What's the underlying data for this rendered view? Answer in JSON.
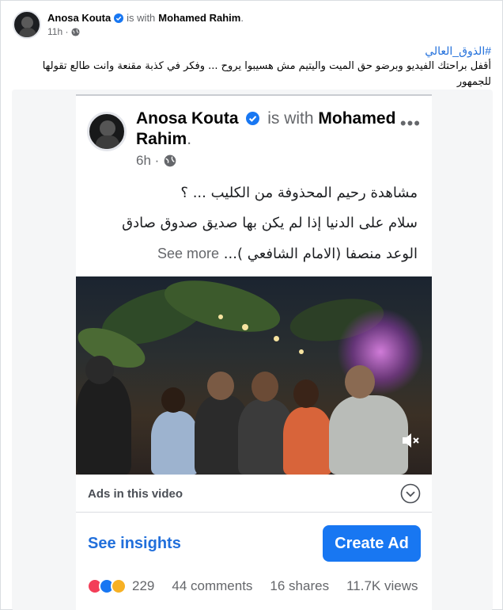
{
  "post": {
    "author": "Anosa Kouta",
    "is_with": "is with",
    "with_name": "Mohamed Rahim",
    "dot": ".",
    "time": "11h",
    "hashtag": "#الذوق_العالي",
    "caption": "أقفل براحتك الفيديو وبرضو حق الميت واليتيم مش هسيبوا يروح ... وفكر في كذبة مقنعة وانت طالع تقولها للجمهور"
  },
  "embedded": {
    "author": "Anosa Kouta",
    "is_with": "is with",
    "with_name": "Mohamed Rahim",
    "dot": ".",
    "time": "6h",
    "more": "•••",
    "line1": "مشاهدة رحيم المحذوفة من الكليب ... ؟",
    "line2": "سلام على الدنيا إذا لم يكن بها صديق صدوق صادق",
    "line3": "الوعد منصفا (الامام الشافعي )...",
    "see_more": "See more",
    "ads_label": "Ads in this video",
    "insights": "See insights",
    "create_ad": "Create Ad",
    "reaction_count": "229",
    "comments": "44 comments",
    "shares": "16 shares",
    "views": "11.7K views"
  },
  "icons": {
    "verified": "verified-badge-icon",
    "globe": "globe-icon",
    "mute": "speaker-muted-icon",
    "chevron": "chevron-down-icon"
  },
  "colors": {
    "link": "#216fdb",
    "button": "#1877f2",
    "muted_text": "#65676b"
  }
}
